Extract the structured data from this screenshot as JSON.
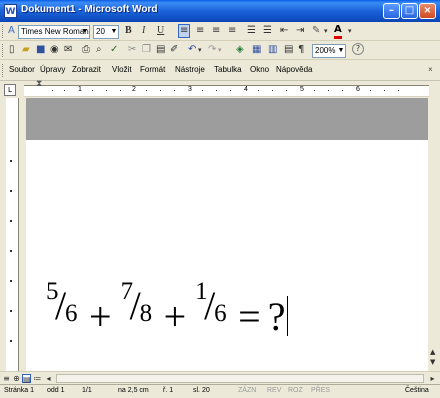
{
  "window": {
    "title": "Dokument1 - Microsoft Word",
    "minimize": "–",
    "maximize": "□",
    "close": "×"
  },
  "format_toolbar": {
    "font_name": "Times New Roman",
    "font_size": "20",
    "bold": "B",
    "italic": "I",
    "underline": "U"
  },
  "standard_toolbar": {
    "zoom": "200%",
    "help": "?"
  },
  "menu": {
    "items": [
      "Soubor",
      "Úpravy",
      "Zobrazit",
      "Vložit",
      "Formát",
      "Nástroje",
      "Tabulka",
      "Okno",
      "Nápověda"
    ],
    "more": "×"
  },
  "ruler": {
    "numbers": [
      "1",
      "2",
      "3",
      "4",
      "5",
      "6"
    ]
  },
  "document": {
    "equation": {
      "f1": {
        "num": "5",
        "den": "6"
      },
      "f2": {
        "num": "7",
        "den": "8"
      },
      "f3": {
        "num": "1",
        "den": "6"
      },
      "plus": "+",
      "equals": "=",
      "result": "?"
    }
  },
  "status_bar": {
    "page": "Stránka 1",
    "section": "odd 1",
    "pages": "1/1",
    "position": "na 2,5 cm",
    "line": "ř. 1",
    "column": "sl. 20",
    "rec": "ZÁZN",
    "trk": "REV",
    "ext": "ROZ",
    "ovr": "PŘES",
    "language": "Čeština"
  },
  "colors": {
    "title_blue": "#1b63d8",
    "chrome": "#ece9d8"
  }
}
